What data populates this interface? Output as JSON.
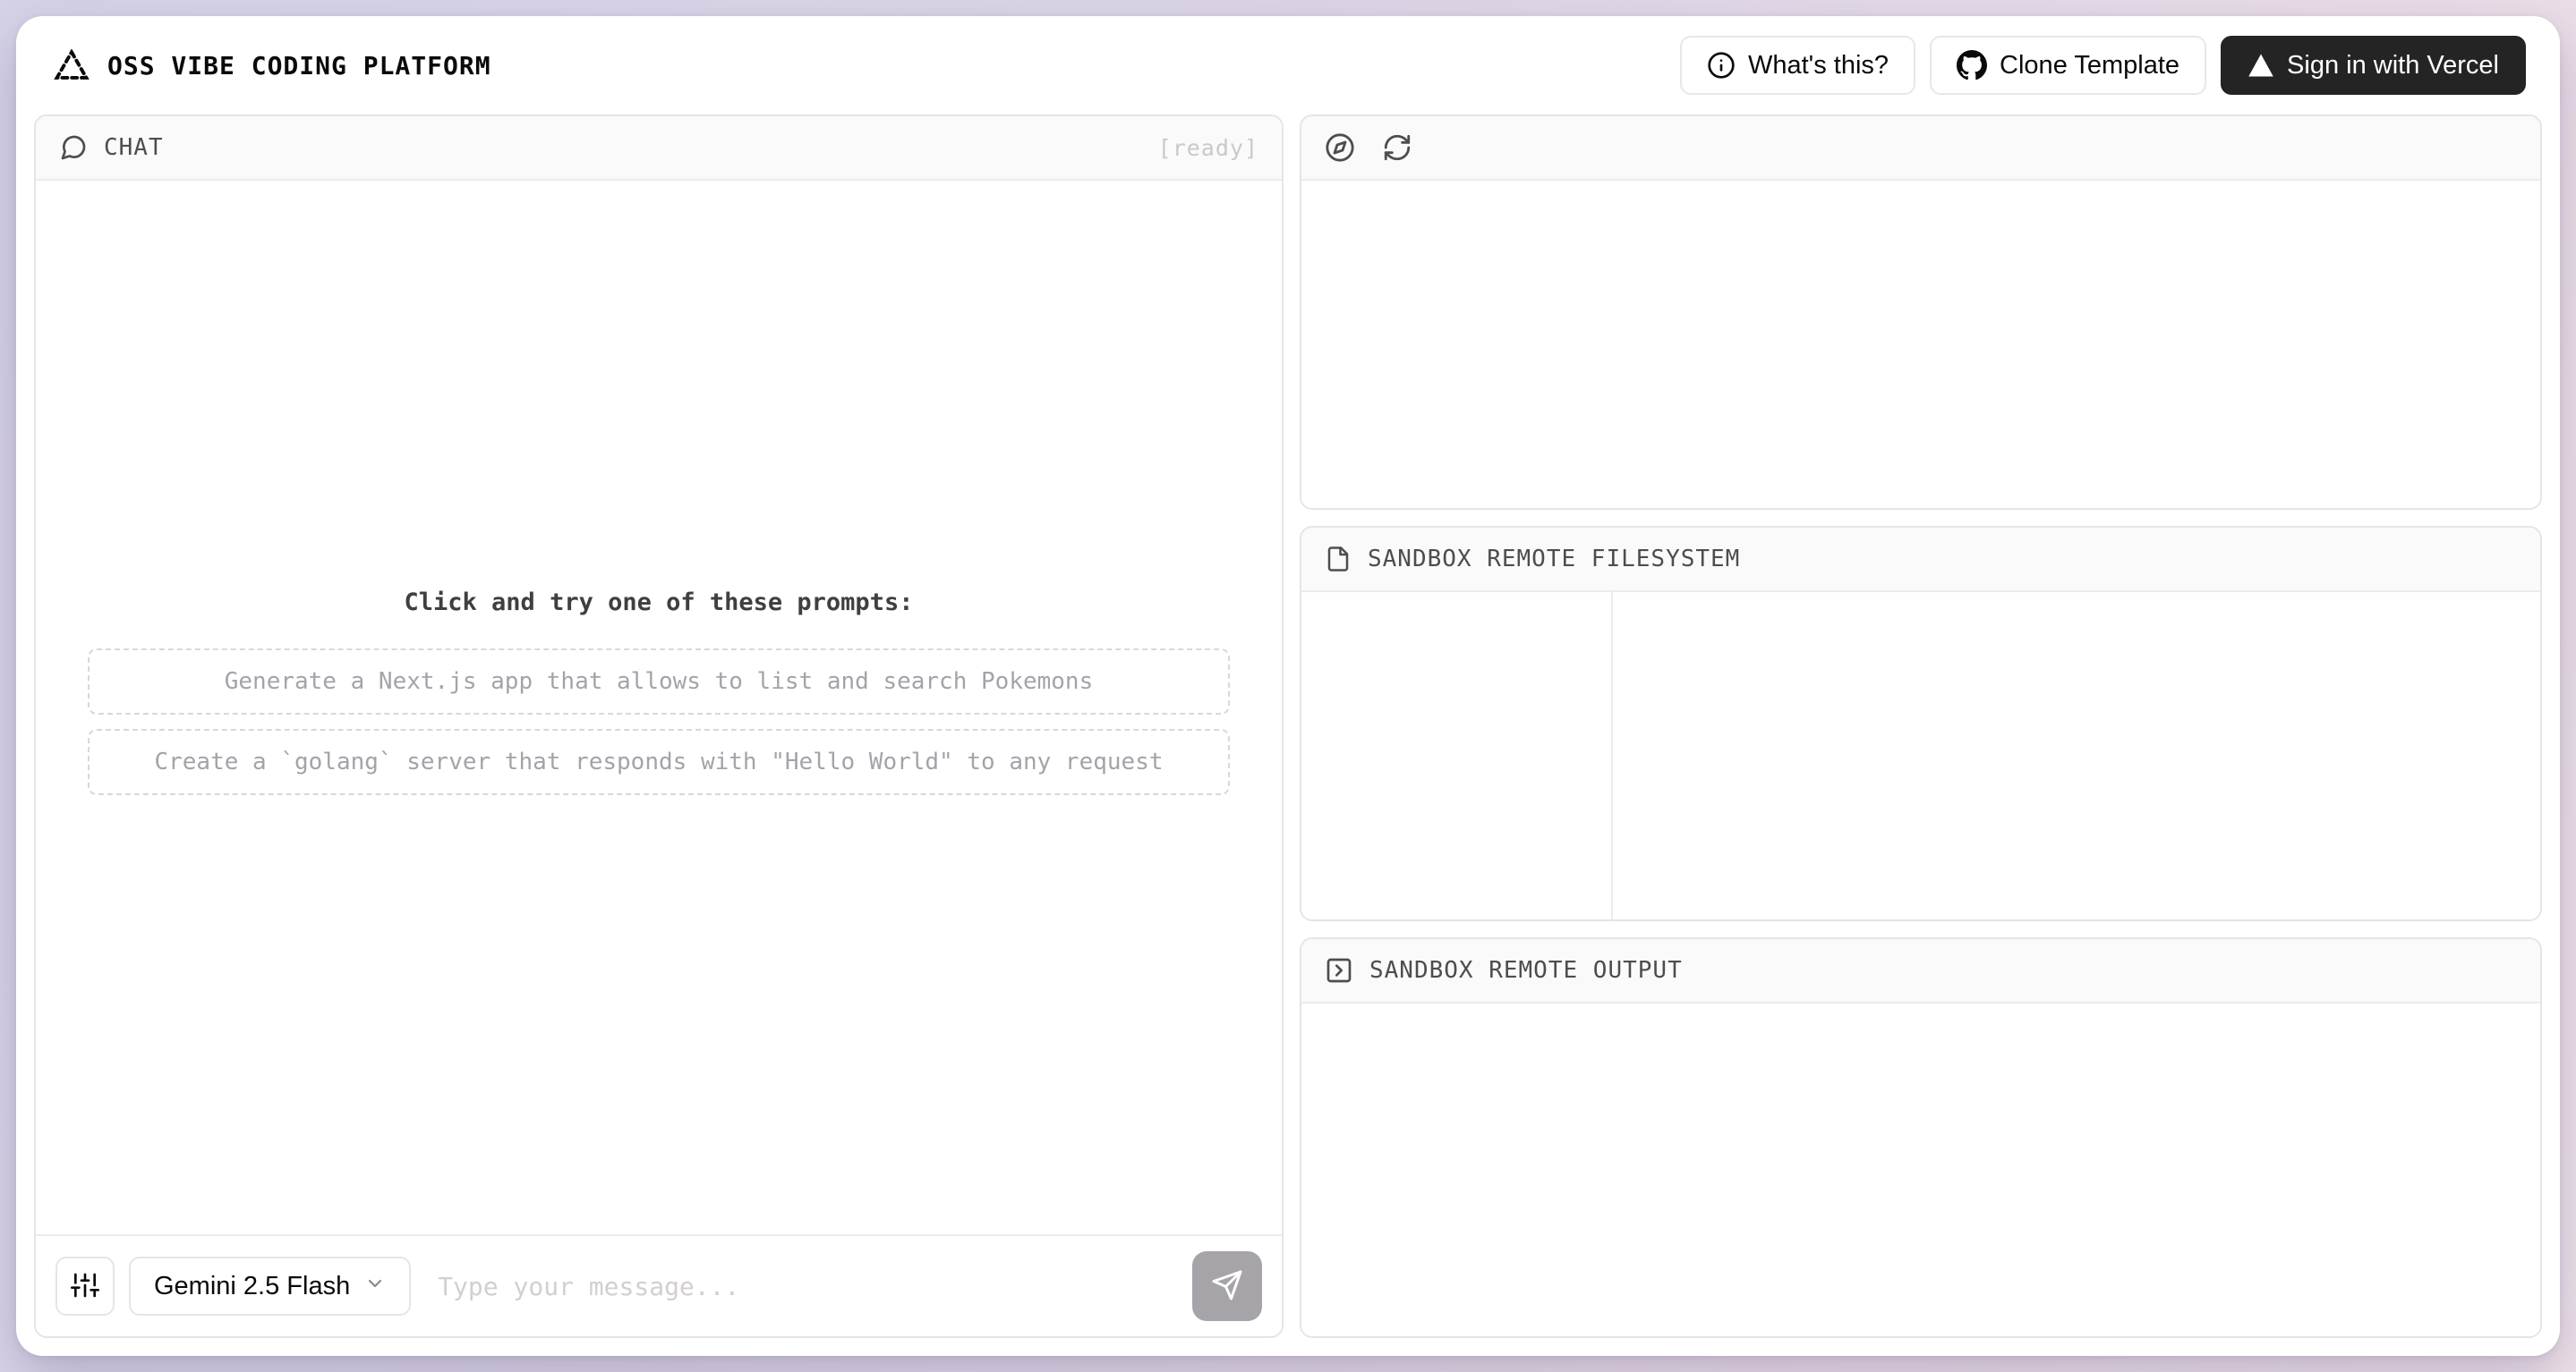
{
  "header": {
    "title": "OSS VIBE CODING PLATFORM",
    "whats_this_label": "What's this?",
    "clone_template_label": "Clone Template",
    "sign_in_label": "Sign in with Vercel"
  },
  "chat": {
    "title": "CHAT",
    "status": "[ready]",
    "prompts_heading": "Click and try one of these prompts:",
    "prompts": [
      "Generate a Next.js app that allows to list and search Pokemons",
      "Create a `golang` server that responds with \"Hello World\" to any request"
    ],
    "model_selector": "Gemini 2.5 Flash",
    "input_placeholder": "Type your message..."
  },
  "sandbox": {
    "filesystem_title": "SANDBOX REMOTE FILESYSTEM",
    "output_title": "SANDBOX REMOTE OUTPUT"
  },
  "colors": {
    "page_background_start": "#d6d3e7",
    "page_background_end": "#eee3e9",
    "card_background": "#ffffff",
    "panel_border": "#e6e4ea",
    "panel_header_background": "#fafafa",
    "dark_button": "#242424",
    "muted_prompt_text": "#a5a2a9",
    "status_text": "#ccc7ca",
    "send_button_disabled": "#a6a4a9"
  }
}
